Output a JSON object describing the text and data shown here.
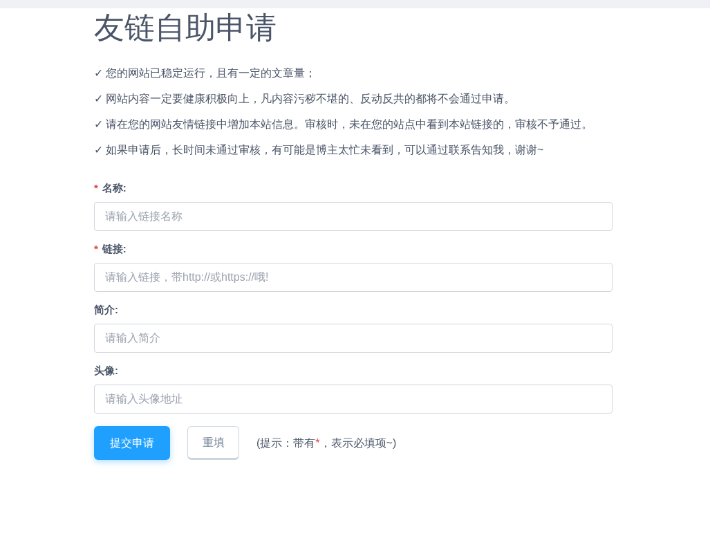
{
  "title": "友链自助申请",
  "rules": [
    {
      "mark": "✓",
      "text": "您的网站已稳定运行，且有一定的文章量；"
    },
    {
      "mark": "✓",
      "text": "网站内容一定要健康积极向上，凡内容污秽不堪的、反动反共的都将不会通过申请。"
    },
    {
      "mark": "✓",
      "text": "请在您的网站友情链接中增加本站信息。审核时，未在您的站点中看到本站链接的，审核不予通过。"
    },
    {
      "mark": "✓",
      "text": "如果申请后，长时间未通过审核，有可能是博主太忙未看到，可以通过联系告知我，谢谢~"
    }
  ],
  "fields": [
    {
      "label": "名称:",
      "required": true,
      "required_mark": "*",
      "placeholder": "请输入链接名称"
    },
    {
      "label": "链接:",
      "required": true,
      "required_mark": "*",
      "placeholder": "请输入链接，带http://或https://哦!"
    },
    {
      "label": "简介:",
      "required": false,
      "placeholder": "请输入简介"
    },
    {
      "label": "头像:",
      "required": false,
      "placeholder": "请输入头像地址"
    }
  ],
  "buttons": [
    {
      "kind": "primary",
      "label": "提交申请"
    },
    {
      "kind": "plain",
      "label": "重填"
    }
  ],
  "hint": {
    "before": "(提示：带有",
    "mark": "*",
    "after": "，表示必填项~)"
  }
}
